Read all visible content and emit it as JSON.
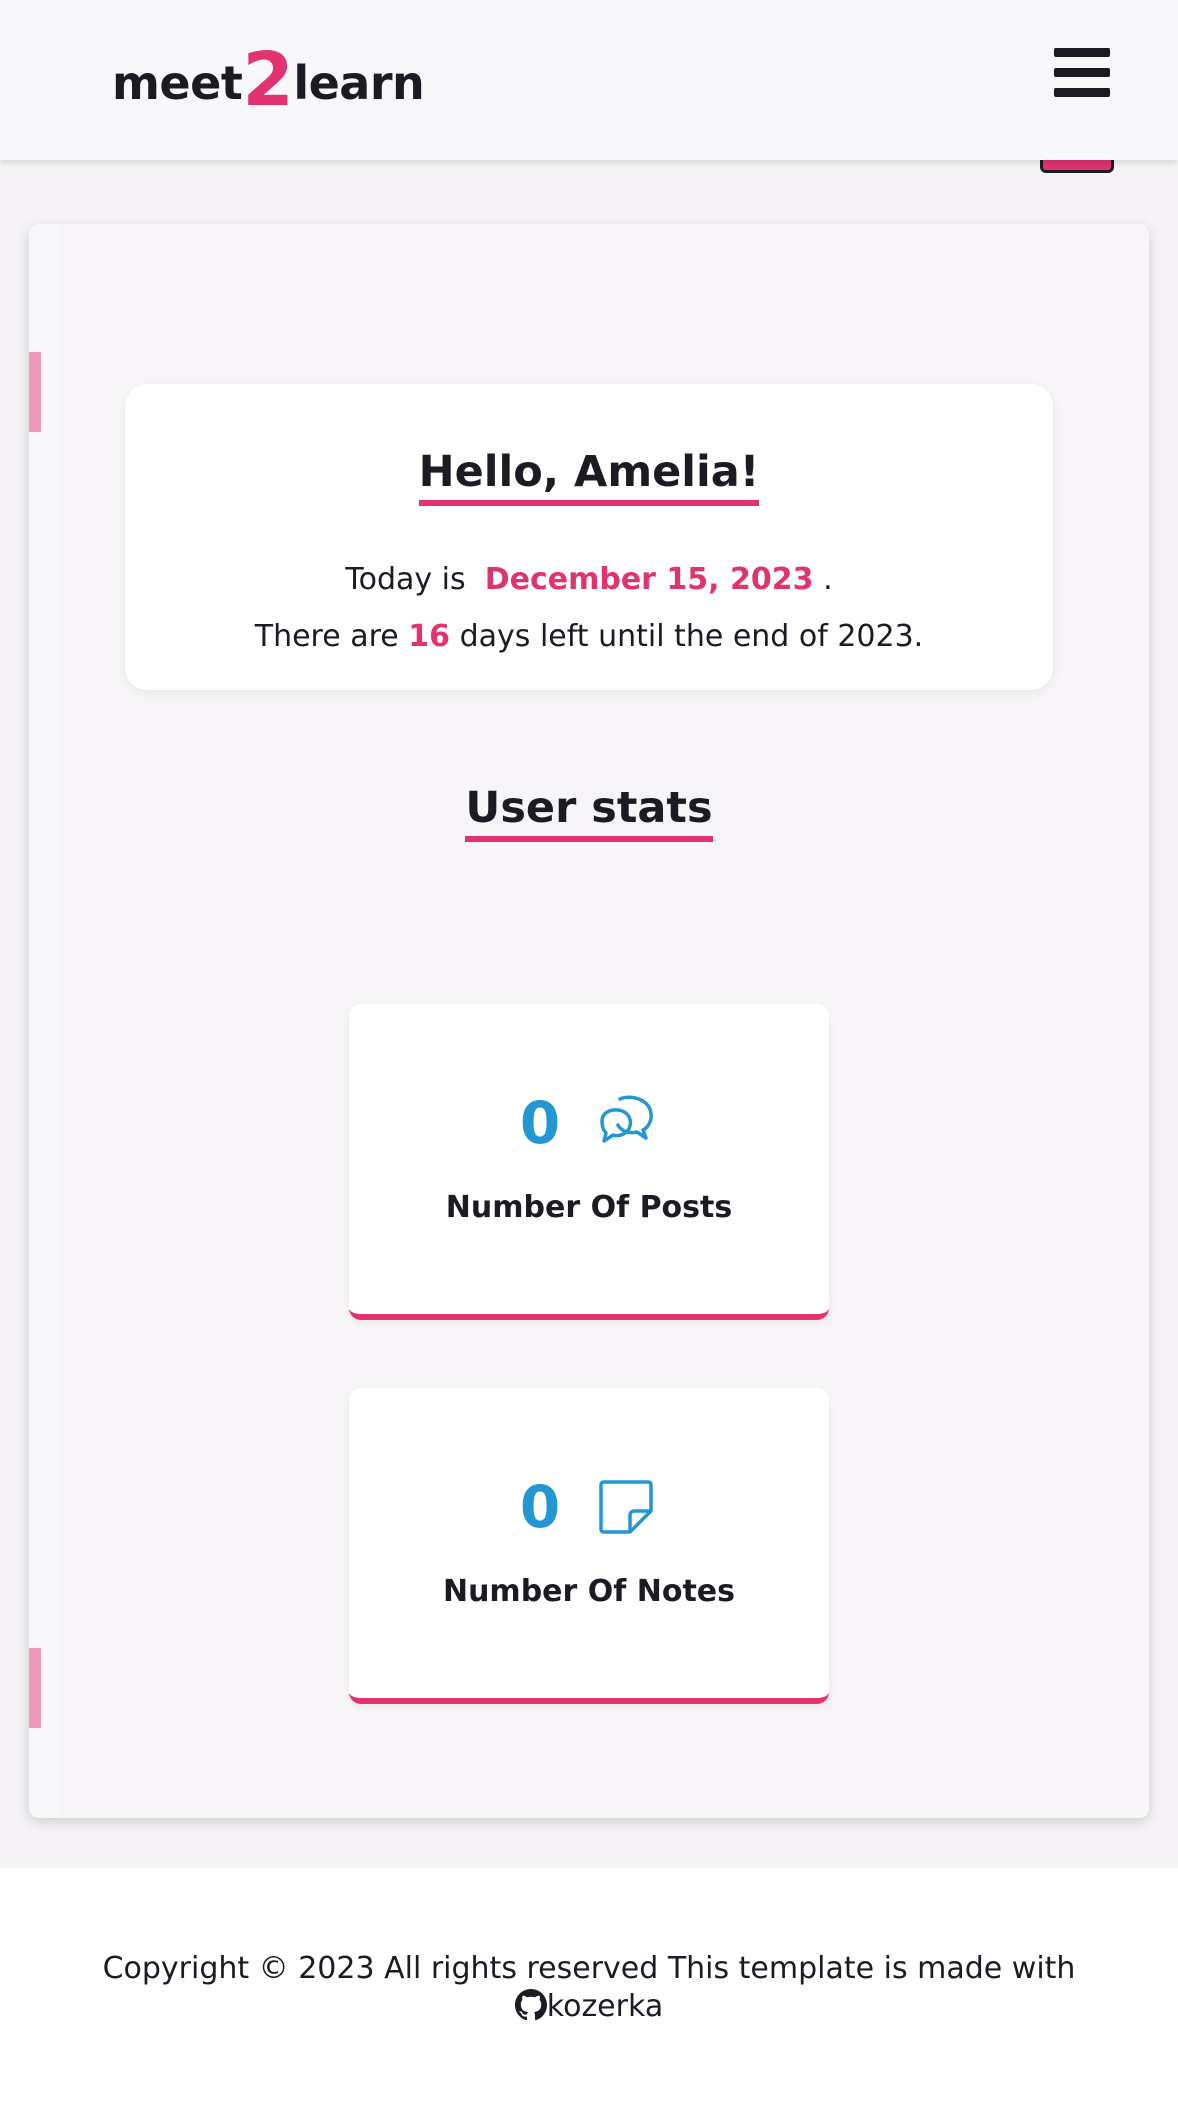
{
  "header": {
    "logo_prefix": "meet",
    "logo_accent": "2",
    "logo_suffix": "learn",
    "menu_icon": "hamburger-menu-icon"
  },
  "greeting": {
    "title": "Hello, Amelia!",
    "today_prefix": "Today is",
    "date": "December 15, 2023",
    "today_suffix": ".",
    "days_prefix": "There are",
    "days_left": "16",
    "days_suffix": "days left until the end of 2023."
  },
  "stats": {
    "title": "User stats",
    "posts": {
      "count": "0",
      "label": "Number Of Posts",
      "icon": "chat-bubbles-icon"
    },
    "notes": {
      "count": "0",
      "label": "Number Of Notes",
      "icon": "sticky-note-icon"
    }
  },
  "footer": {
    "copyright": "Copyright © 2023 All rights reserved This template is made with",
    "author_link": "kozerka",
    "author_icon": "github-icon"
  },
  "colors": {
    "accent": "#e0336f",
    "stat_blue": "#2396d4",
    "text_dark": "#1b1b24"
  }
}
